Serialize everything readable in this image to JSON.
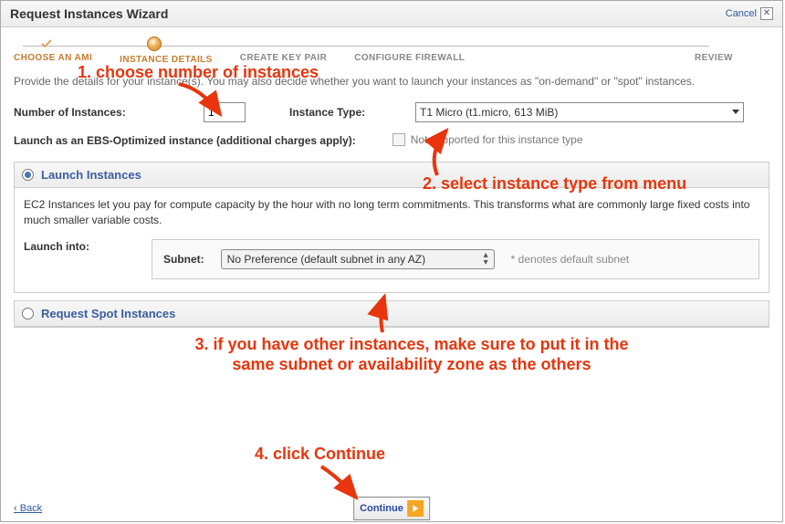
{
  "header": {
    "title": "Request Instances Wizard",
    "cancel": "Cancel"
  },
  "steps": {
    "s1": "CHOOSE AN AMI",
    "s2": "INSTANCE DETAILS",
    "s3": "CREATE KEY PAIR",
    "s4": "CONFIGURE FIREWALL",
    "s5": "REVIEW"
  },
  "intro": "Provide the details for your instance(s). You may also decide whether you want to launch your instances as \"on-demand\" or \"spot\" instances.",
  "form": {
    "num_label": "Number of Instances:",
    "num_value": "1",
    "type_label": "Instance Type:",
    "type_value": "T1 Micro (t1.micro, 613 MiB)",
    "ebs_label": "Launch as an EBS-Optimized instance (additional charges apply):",
    "ebs_note": "Not supported for this instance type"
  },
  "launch_panel": {
    "title": "Launch Instances",
    "desc": "EC2 Instances let you pay for compute capacity by the hour with no long term commitments. This transforms what are commonly large fixed costs into much smaller variable costs.",
    "into_label": "Launch into:",
    "subnet_label": "Subnet:",
    "subnet_value": "No Preference (default subnet in any AZ)",
    "default_note": "* denotes default subnet"
  },
  "spot_panel": {
    "title": "Request Spot Instances"
  },
  "footer": {
    "back": "‹ Back",
    "continue": "Continue"
  },
  "annotations": {
    "a1": "1. choose number of instances",
    "a2": "2. select instance type from menu",
    "a3a": "3. if you have other instances, make sure to put it in the",
    "a3b": "same subnet or availability zone as the others",
    "a4": "4. click Continue"
  }
}
